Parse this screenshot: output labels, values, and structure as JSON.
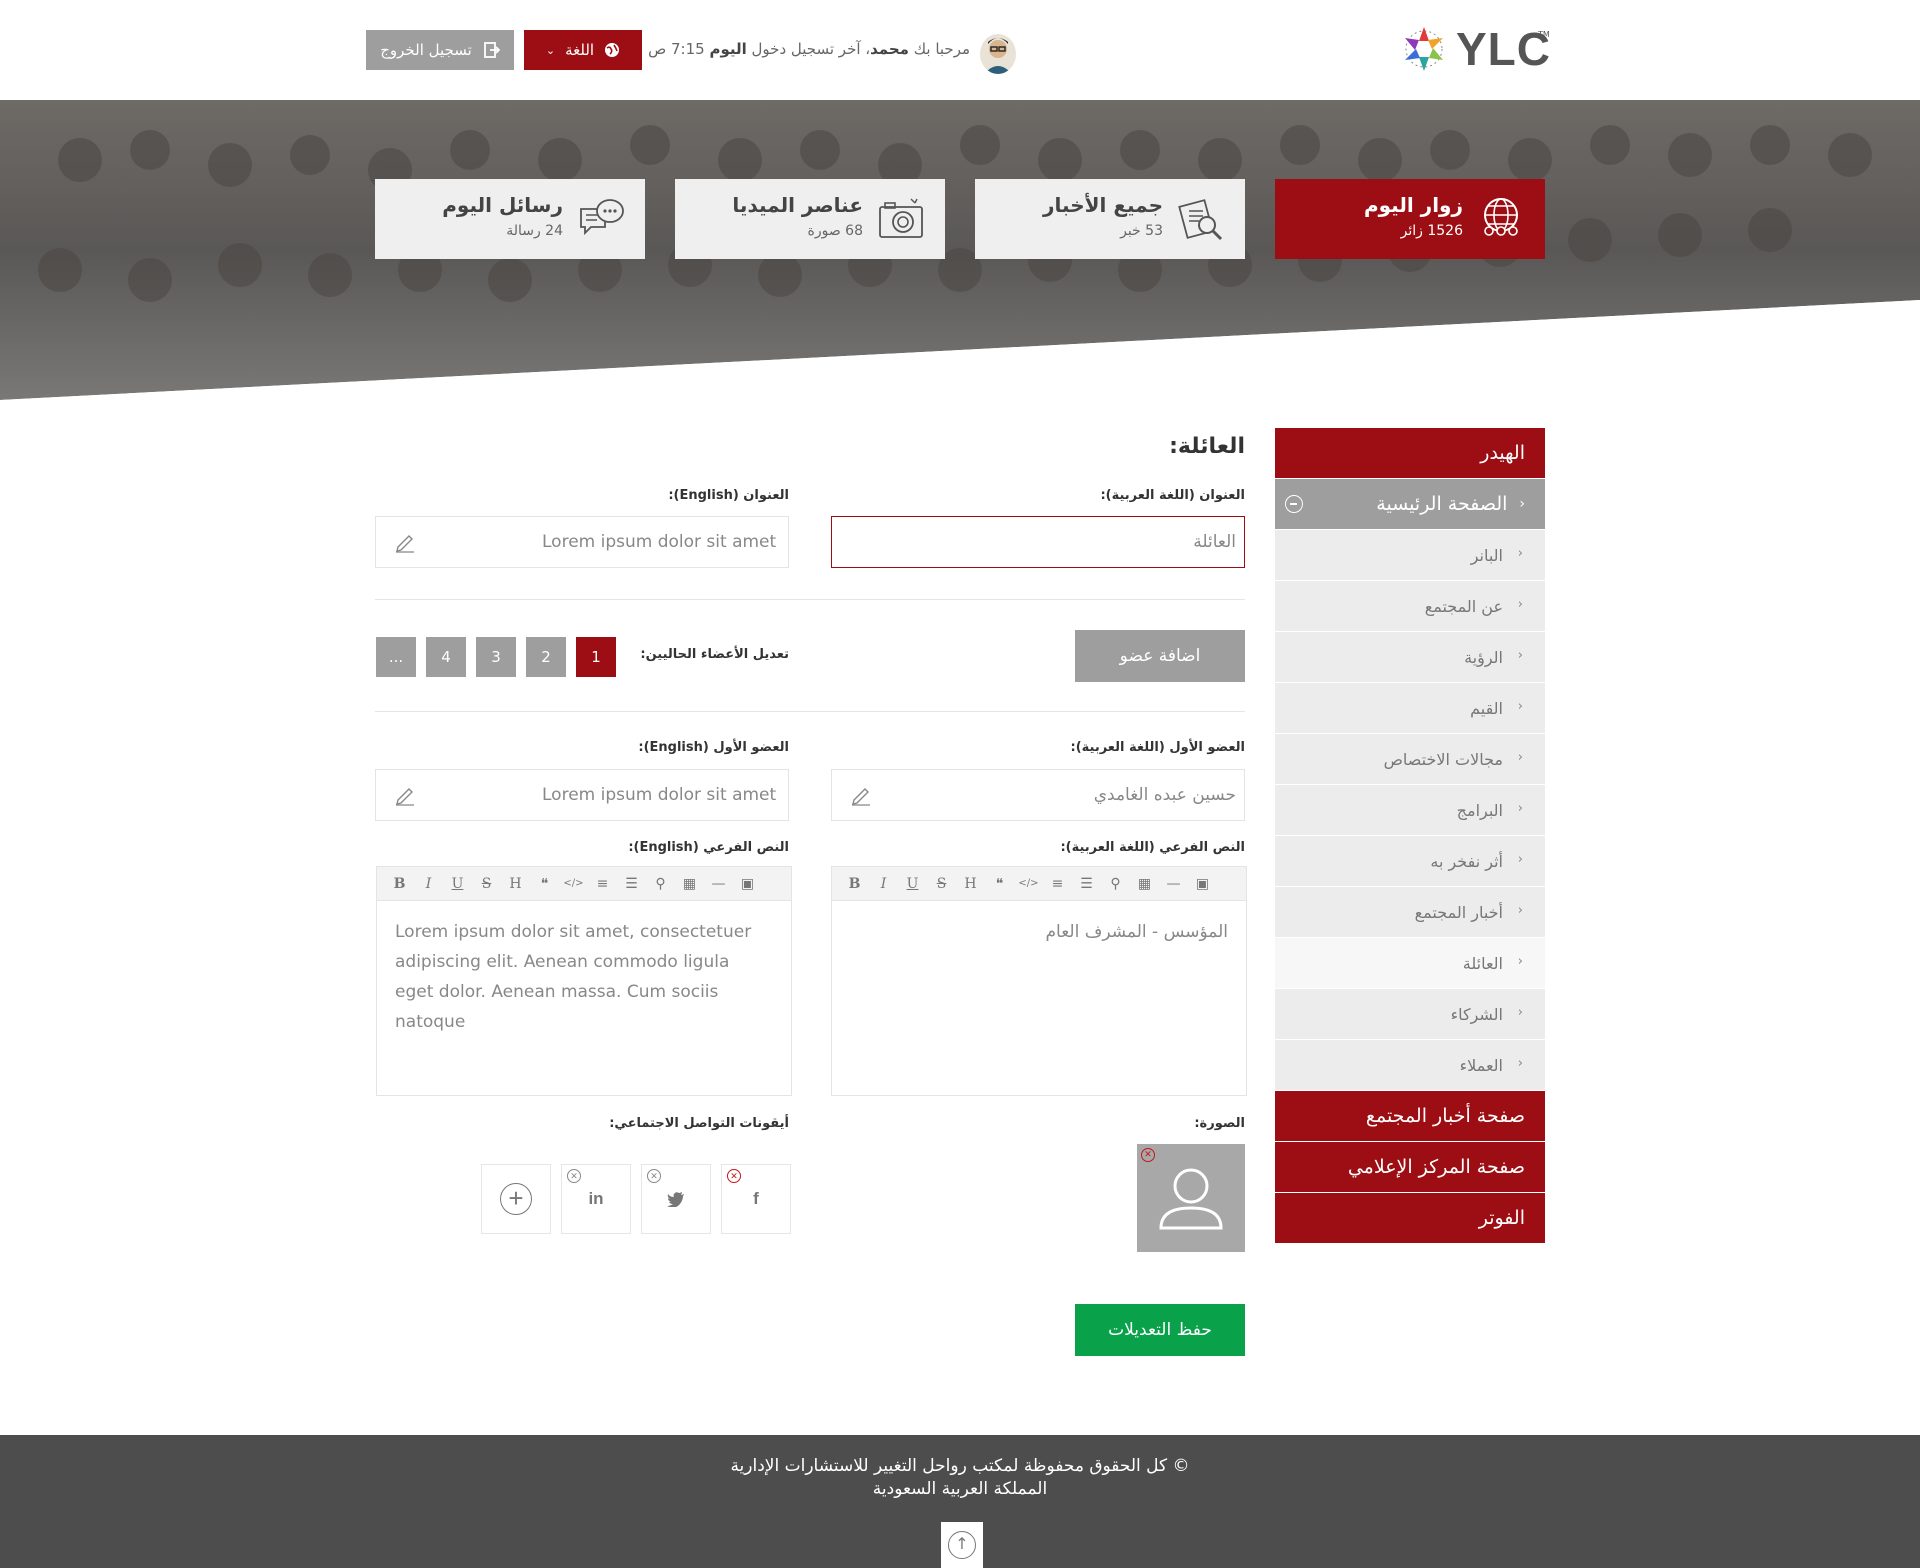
{
  "header": {
    "logo_text": "YLC",
    "logo_tm": "TM",
    "welcome_prefix": "مرحبا بك",
    "user_name": "محمد",
    "last_login_prefix": "، آخر تسجيل دخول",
    "last_login_day": "اليوم",
    "last_login_time": "7:15 ص",
    "language_label": "اللغة",
    "logout_label": "تسجيل الخروج"
  },
  "stats": [
    {
      "title": "زوار اليوم",
      "sub": "1526 زائر",
      "icon": "globe-people-icon",
      "active": true
    },
    {
      "title": "جميع الأخبار",
      "sub": "53 خبر",
      "icon": "news-search-icon",
      "active": false
    },
    {
      "title": "عناصر الميديا",
      "sub": "68 صورة",
      "icon": "camera-icon",
      "active": false
    },
    {
      "title": "رسائل اليوم",
      "sub": "24 رسالة",
      "icon": "chat-bubbles-icon",
      "active": false
    }
  ],
  "sidebar": {
    "header": "الهيدر",
    "home": "الصفحة الرئيسية",
    "items": [
      "البانر",
      "عن المجتمع",
      "الرؤية",
      "القيم",
      "مجالات الاختصاص",
      "البرامج",
      "أثر نفخر به",
      "أخبار المجتمع",
      "العائلة",
      "الشركاء",
      "العملاء"
    ],
    "active_item": "العائلة",
    "pages": [
      "صفحة أخبار المجتمع",
      "صفحة المركز الإعلامي",
      "الفوتر"
    ]
  },
  "form": {
    "section_title": "العائلة:",
    "title_ar_label": "العنوان (اللغة العربية):",
    "title_ar_value": "العائلة",
    "title_en_label": "العنوان (English):",
    "title_en_value": "Lorem ipsum dolor sit amet",
    "add_member": "اضافة عضو",
    "edit_members_label": "تعديل الأعضاء الحاليين:",
    "pages": [
      "1",
      "2",
      "3",
      "4",
      "..."
    ],
    "current_page": "1",
    "member_ar_label": "العضو الأول (اللغة العربية):",
    "member_ar_value": "حسين عبده الغامدي",
    "member_en_label": "العضو الأول (English):",
    "member_en_value": "Lorem ipsum dolor sit amet",
    "subtext_ar_label": "النص الفرعي (اللغة العربية):",
    "subtext_ar_value": "المؤسس - المشرف العام",
    "subtext_en_label": "النص الفرعي (English):",
    "subtext_en_value": "Lorem ipsum dolor sit amet, consectetuer adipiscing elit. Aenean commodo ligula eget dolor. Aenean massa. Cum sociis natoque",
    "toolbar": [
      "B",
      "I",
      "U",
      "S",
      "H",
      "❝",
      "</>",
      "≡",
      "☰",
      "⚲",
      "▦",
      "—",
      "▣"
    ],
    "photo_label": "الصورة:",
    "social_label": "أيقونات التواصل الاجتماعي:",
    "social": [
      "f",
      "t",
      "in"
    ],
    "save": "حفظ التعديلات"
  },
  "footer": {
    "line1": "© كل الحقوق محفوظة لمكتب رواحل التغيير للاستشارات الإدارية",
    "line2": "المملكة العربية السعودية"
  },
  "colors": {
    "brand": "#9c0e13",
    "gray_button": "#9e9e9e",
    "save_green": "#0aa14b",
    "footer_bg": "#4d4d4d"
  }
}
